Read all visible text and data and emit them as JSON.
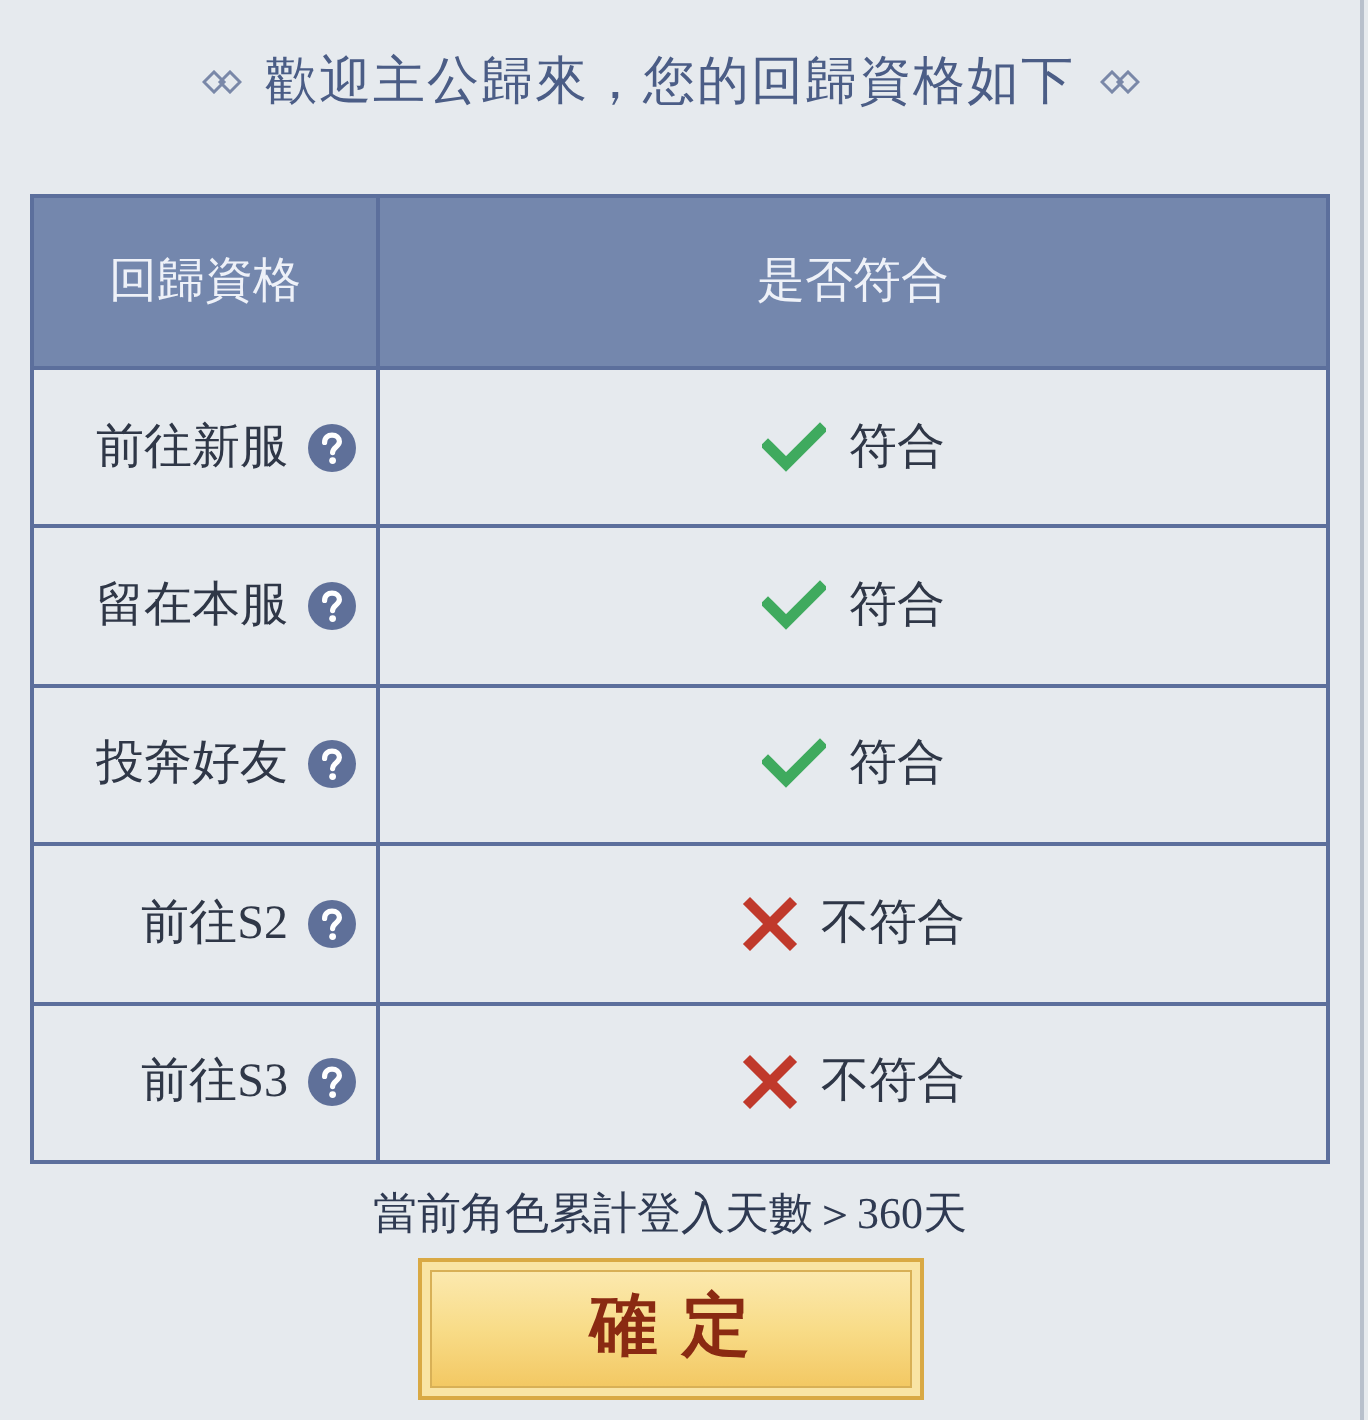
{
  "title": "歡迎主公歸來，您的回歸資格如下",
  "table": {
    "columns": [
      "回歸資格",
      "是否符合"
    ],
    "rows": [
      {
        "option": "前往新服",
        "eligible": true,
        "status": "符合"
      },
      {
        "option": "留在本服",
        "eligible": true,
        "status": "符合"
      },
      {
        "option": "投奔好友",
        "eligible": true,
        "status": "符合"
      },
      {
        "option": "前往S2",
        "eligible": false,
        "status": "不符合"
      },
      {
        "option": "前往S3",
        "eligible": false,
        "status": "不符合"
      }
    ]
  },
  "note": "當前角色累計登入天數＞360天",
  "confirm_button": "確定"
}
